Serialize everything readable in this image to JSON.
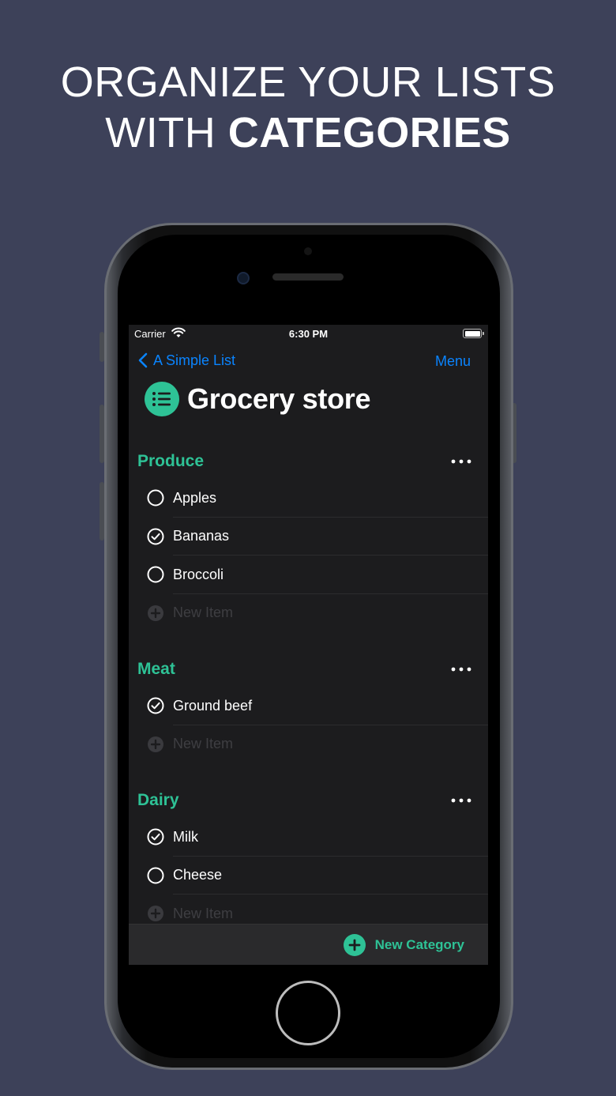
{
  "headline": {
    "line1": "ORGANIZE YOUR LISTS",
    "line2_regular": "WITH ",
    "line2_bold": "CATEGORIES"
  },
  "status_bar": {
    "carrier": "Carrier",
    "time": "6:30 PM"
  },
  "nav": {
    "back_label": "A Simple List",
    "menu_label": "Menu"
  },
  "page": {
    "title": "Grocery store",
    "icon": "list-icon"
  },
  "categories": [
    {
      "name": "Produce",
      "items": [
        {
          "label": "Apples",
          "checked": false
        },
        {
          "label": "Bananas",
          "checked": true
        },
        {
          "label": "Broccoli",
          "checked": false
        }
      ],
      "new_item": "New Item"
    },
    {
      "name": "Meat",
      "items": [
        {
          "label": "Ground beef",
          "checked": true
        }
      ],
      "new_item": "New Item"
    },
    {
      "name": "Dairy",
      "items": [
        {
          "label": "Milk",
          "checked": true
        },
        {
          "label": "Cheese",
          "checked": false
        }
      ],
      "new_item": "New Item"
    }
  ],
  "bottom_bar": {
    "new_category_label": "New Category"
  },
  "colors": {
    "accent": "#2ec296",
    "link": "#0a84ff",
    "background": "#3d4159",
    "screen": "#1c1c1e"
  }
}
